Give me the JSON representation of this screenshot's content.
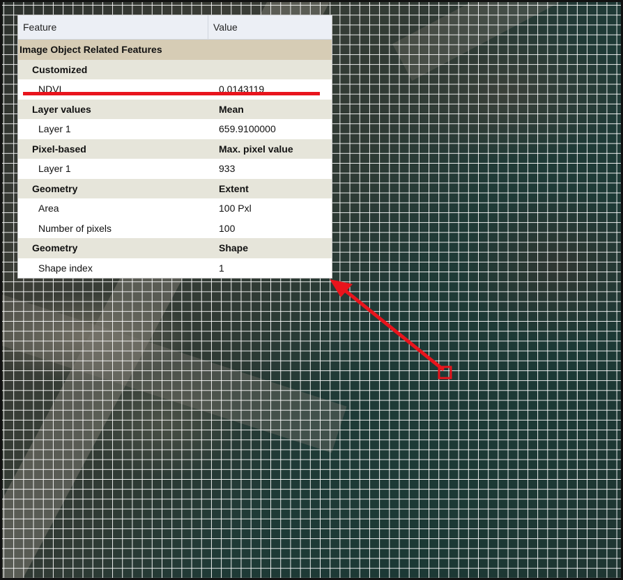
{
  "panel": {
    "columns": {
      "feature": "Feature",
      "value": "Value"
    },
    "category": "Image Object Related Features",
    "rows": [
      {
        "kind": "grp",
        "name": "Customized",
        "value": ""
      },
      {
        "kind": "item",
        "name": "NDVI",
        "value": "0.0143119"
      },
      {
        "kind": "grp",
        "name": "Layer values",
        "value": "Mean"
      },
      {
        "kind": "item",
        "name": "Layer 1",
        "value": "659.9100000"
      },
      {
        "kind": "grp",
        "name": "Pixel-based",
        "value": "Max. pixel value"
      },
      {
        "kind": "item",
        "name": "Layer 1",
        "value": "933"
      },
      {
        "kind": "grp",
        "name": "Geometry",
        "value": "Extent"
      },
      {
        "kind": "item",
        "name": "Area",
        "value": "100 Pxl"
      },
      {
        "kind": "item",
        "name": "Number of pixels",
        "value": "100"
      },
      {
        "kind": "grp",
        "name": "Geometry",
        "value": "Shape"
      },
      {
        "kind": "item",
        "name": "Shape index",
        "value": "1"
      }
    ]
  },
  "colors": {
    "annotation": "#e8141c",
    "grid": "#ffffff",
    "category_bg": "#d6ccb5",
    "group_bg": "#e6e5da"
  }
}
